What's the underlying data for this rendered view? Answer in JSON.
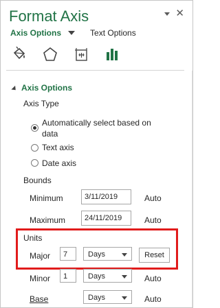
{
  "pane": {
    "title": "Format Axis",
    "header_icons": [
      "dropdown-arrow-icon",
      "close-icon"
    ],
    "close_glyph": "✕"
  },
  "tabs": {
    "axis_options": "Axis Options",
    "text_options": "Text Options"
  },
  "icon_tabs": [
    "fill-line-icon",
    "effects-icon",
    "size-properties-icon",
    "axis-options-icon"
  ],
  "section": {
    "title": "Axis Options"
  },
  "axis_type": {
    "label": "Axis Type",
    "options": [
      {
        "line1": "Automatically select based on",
        "line2": "data",
        "checked": true
      },
      {
        "label": "Text axis",
        "checked": false
      },
      {
        "label": "Date axis",
        "checked": false
      }
    ]
  },
  "bounds": {
    "label": "Bounds",
    "minimum": {
      "label": "Minimum",
      "value": "3/11/2019",
      "auto": "Auto"
    },
    "maximum": {
      "label": "Maximum",
      "value": "24/11/2019",
      "auto": "Auto"
    }
  },
  "units": {
    "label": "Units",
    "major": {
      "label": "Major",
      "value": "7",
      "unit": "Days",
      "button": "Reset"
    },
    "minor": {
      "label": "Minor",
      "value": "1",
      "unit": "Days",
      "auto": "Auto"
    }
  },
  "base": {
    "label": "Base",
    "unit": "Days",
    "auto": "Auto"
  },
  "colors": {
    "accent": "#217346",
    "highlight": "#e11b1b"
  }
}
